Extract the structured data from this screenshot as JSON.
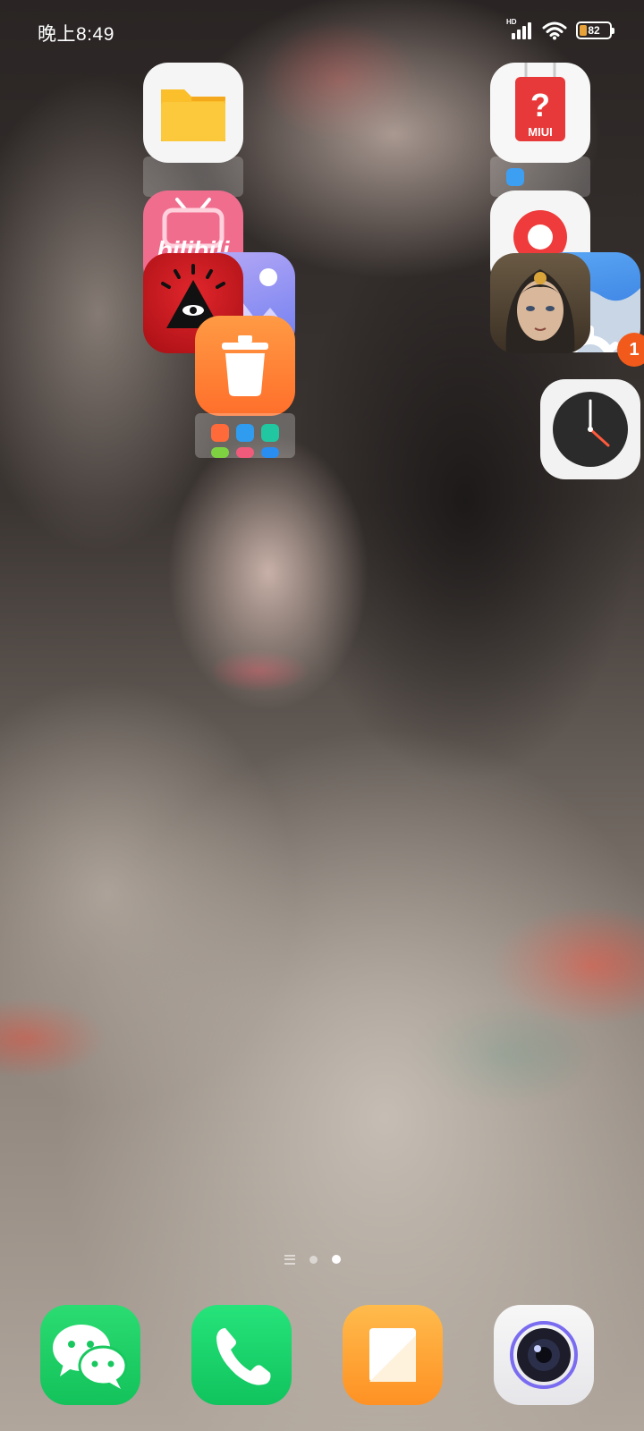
{
  "status_bar": {
    "time": "晚上8:49",
    "network_label": "HD",
    "battery_percent": "82"
  },
  "home_screen": {
    "apps": [
      {
        "name": "file-manager",
        "icon": "folder-icon"
      },
      {
        "name": "miui-feedback",
        "icon": "question-mark-icon",
        "label": "MIUI"
      },
      {
        "name": "bilibili",
        "icon": "bilibili-tv-icon",
        "label": "bilibili"
      },
      {
        "name": "screen-recorder",
        "icon": "record-icon"
      },
      {
        "name": "eye-triangle-game",
        "icon": "eye-pyramid-icon"
      },
      {
        "name": "anime-portrait-app",
        "icon": "portrait-icon"
      },
      {
        "name": "gallery",
        "icon": "mountain-icon"
      },
      {
        "name": "settings",
        "icon": "gear-icon",
        "badge": "1"
      },
      {
        "name": "cleaner",
        "icon": "trash-can-icon"
      },
      {
        "name": "clock",
        "icon": "clock-icon"
      }
    ],
    "folder_mini_icons": [
      "video-icon",
      "compass-icon",
      "scan-icon",
      "download-icon",
      "store-icon",
      "browser-icon"
    ]
  },
  "page_indicator": {
    "pages": 2,
    "active_index": 1
  },
  "dock": [
    {
      "name": "wechat",
      "icon": "wechat-icon"
    },
    {
      "name": "phone",
      "icon": "phone-icon"
    },
    {
      "name": "notes",
      "icon": "notes-icon"
    },
    {
      "name": "camera",
      "icon": "camera-icon"
    }
  ],
  "colors": {
    "files_bg": "#f5f5f5",
    "folder_yellow": "#fbbf2c",
    "miui_red": "#e8393a",
    "bilibili_pink": "#f06d8e",
    "recorder_red": "#ef3b3b",
    "eye_red": "#c4161c",
    "gallery_purple": "#8a86f0",
    "settings_blue": "#3f8fe8",
    "cleaner_orange": "#ff7f2e",
    "badge_orange": "#f25a1b",
    "wechat_green": "#1fd066",
    "phone_green": "#18d365",
    "notes_orange": "#ffa233"
  }
}
